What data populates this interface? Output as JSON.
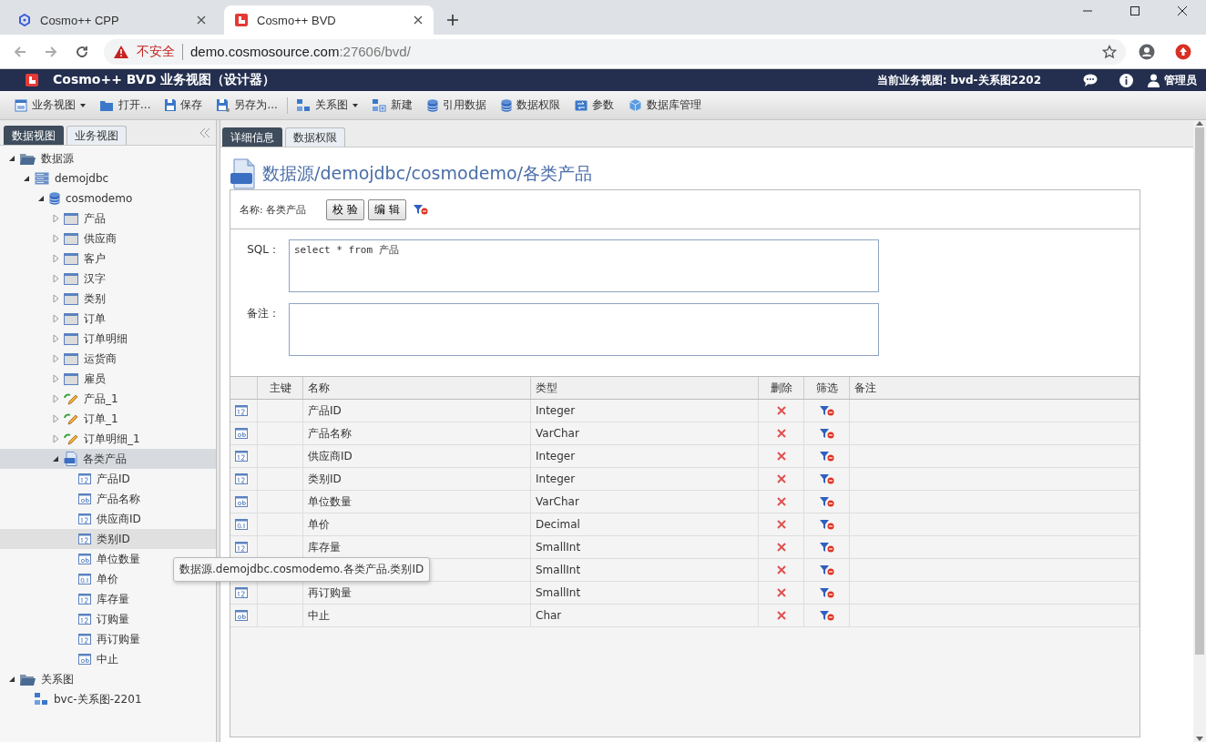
{
  "browser": {
    "tabs": [
      {
        "title": "Cosmo++ CPP",
        "selected": false,
        "kind": "cpp"
      },
      {
        "title": "Cosmo++ BVD",
        "selected": true,
        "kind": "bvd"
      }
    ],
    "security": "不安全",
    "url_host": "demo.cosmosource.com",
    "url_rest": ":27606/bvd/"
  },
  "app": {
    "title": "Cosmo++ BVD 业务视图（设计器）",
    "current_view": "当前业务视图: bvd-关系图2202",
    "user": "管理员"
  },
  "toolbar": [
    {
      "label": "业务视图",
      "kind": "view",
      "dropdown": true
    },
    {
      "label": "打开...",
      "kind": "open",
      "dropdown": false
    },
    {
      "label": "保存",
      "kind": "save",
      "dropdown": false
    },
    {
      "label": "另存为...",
      "kind": "saveas",
      "dropdown": false
    },
    {
      "label": "关系图",
      "kind": "diagram",
      "dropdown": true
    },
    {
      "label": "新建",
      "kind": "new",
      "dropdown": false
    },
    {
      "label": "引用数据",
      "kind": "db",
      "dropdown": false
    },
    {
      "label": "数据权限",
      "kind": "db",
      "dropdown": false
    },
    {
      "label": "参数",
      "kind": "param",
      "dropdown": false
    },
    {
      "label": "数据库管理",
      "kind": "cube",
      "dropdown": false
    }
  ],
  "sidebar": {
    "tabs": [
      {
        "label": "数据视图",
        "selected": true
      },
      {
        "label": "业务视图",
        "selected": false
      }
    ],
    "tree": [
      {
        "label": "数据源",
        "kind": "folder",
        "expanded": true,
        "selected": false,
        "hovered": false,
        "children": [
          {
            "label": "demojdbc",
            "kind": "server",
            "expanded": true,
            "selected": false,
            "hovered": false,
            "children": [
              {
                "label": "cosmodemo",
                "kind": "db",
                "expanded": true,
                "selected": false,
                "hovered": false,
                "children": [
                  {
                    "label": "产品",
                    "kind": "table",
                    "expanded": false,
                    "selected": false,
                    "hovered": false
                  },
                  {
                    "label": "供应商",
                    "kind": "table",
                    "expanded": false,
                    "selected": false,
                    "hovered": false
                  },
                  {
                    "label": "客户",
                    "kind": "table",
                    "expanded": false,
                    "selected": false,
                    "hovered": false
                  },
                  {
                    "label": "汉字",
                    "kind": "table",
                    "expanded": false,
                    "selected": false,
                    "hovered": false
                  },
                  {
                    "label": "类别",
                    "kind": "table",
                    "expanded": false,
                    "selected": false,
                    "hovered": false
                  },
                  {
                    "label": "订单",
                    "kind": "table",
                    "expanded": false,
                    "selected": false,
                    "hovered": false
                  },
                  {
                    "label": "订单明细",
                    "kind": "table",
                    "expanded": false,
                    "selected": false,
                    "hovered": false
                  },
                  {
                    "label": "运货商",
                    "kind": "table",
                    "expanded": false,
                    "selected": false,
                    "hovered": false
                  },
                  {
                    "label": "雇员",
                    "kind": "table",
                    "expanded": false,
                    "selected": false,
                    "hovered": false
                  },
                  {
                    "label": "产品_1",
                    "kind": "edit",
                    "expanded": false,
                    "selected": false,
                    "hovered": false
                  },
                  {
                    "label": "订单_1",
                    "kind": "edit",
                    "expanded": false,
                    "selected": false,
                    "hovered": false
                  },
                  {
                    "label": "订单明细_1",
                    "kind": "edit",
                    "expanded": false,
                    "selected": false,
                    "hovered": false
                  },
                  {
                    "label": "各类产品",
                    "kind": "sql",
                    "expanded": true,
                    "selected": true,
                    "hovered": false,
                    "children": [
                      {
                        "label": "产品ID",
                        "kind": "int",
                        "selected": false,
                        "hovered": false
                      },
                      {
                        "label": "产品名称",
                        "kind": "text",
                        "selected": false,
                        "hovered": false
                      },
                      {
                        "label": "供应商ID",
                        "kind": "int",
                        "selected": false,
                        "hovered": false
                      },
                      {
                        "label": "类别ID",
                        "kind": "int",
                        "selected": false,
                        "hovered": true
                      },
                      {
                        "label": "单位数量",
                        "kind": "text",
                        "selected": false,
                        "hovered": false
                      },
                      {
                        "label": "单价",
                        "kind": "decimal",
                        "selected": false,
                        "hovered": false
                      },
                      {
                        "label": "库存量",
                        "kind": "int",
                        "selected": false,
                        "hovered": false
                      },
                      {
                        "label": "订购量",
                        "kind": "int",
                        "selected": false,
                        "hovered": false
                      },
                      {
                        "label": "再订购量",
                        "kind": "int",
                        "selected": false,
                        "hovered": false
                      },
                      {
                        "label": "中止",
                        "kind": "text",
                        "selected": false,
                        "hovered": false
                      }
                    ]
                  }
                ]
              }
            ]
          }
        ]
      },
      {
        "label": "关系图",
        "kind": "folder",
        "expanded": true,
        "selected": false,
        "hovered": false,
        "children": [
          {
            "label": "bvc-关系图-2201",
            "kind": "diagram",
            "selected": false,
            "hovered": false
          }
        ]
      }
    ]
  },
  "main": {
    "tabs": [
      {
        "label": "详细信息",
        "selected": true
      },
      {
        "label": "数据权限",
        "selected": false
      }
    ],
    "title": "数据源/demojdbc/cosmodemo/各类产品",
    "name_label": "名称: 各类产品",
    "buttons": [
      "校 验",
      "编 辑"
    ],
    "sql_label": "SQL：",
    "sql": "select * from 产品",
    "note_label": "备注：",
    "table": {
      "columns": [
        "主键",
        "名称",
        "类型",
        "删除",
        "筛选",
        "备注"
      ],
      "rows": [
        {
          "kind": "int",
          "name": "产品ID",
          "type": "Integer"
        },
        {
          "kind": "text",
          "name": "产品名称",
          "type": "VarChar"
        },
        {
          "kind": "int",
          "name": "供应商ID",
          "type": "Integer"
        },
        {
          "kind": "int",
          "name": "类别ID",
          "type": "Integer"
        },
        {
          "kind": "text",
          "name": "单位数量",
          "type": "VarChar"
        },
        {
          "kind": "decimal",
          "name": "单价",
          "type": "Decimal"
        },
        {
          "kind": "int",
          "name": "库存量",
          "type": "SmallInt"
        },
        {
          "type": "SmallInt"
        },
        {
          "kind": "int",
          "name": "再订购量",
          "type": "SmallInt"
        },
        {
          "kind": "text",
          "name": "中止",
          "type": "Char"
        }
      ]
    },
    "tooltip": "数据源.demojdbc.cosmodemo.各类产品.类别ID"
  }
}
